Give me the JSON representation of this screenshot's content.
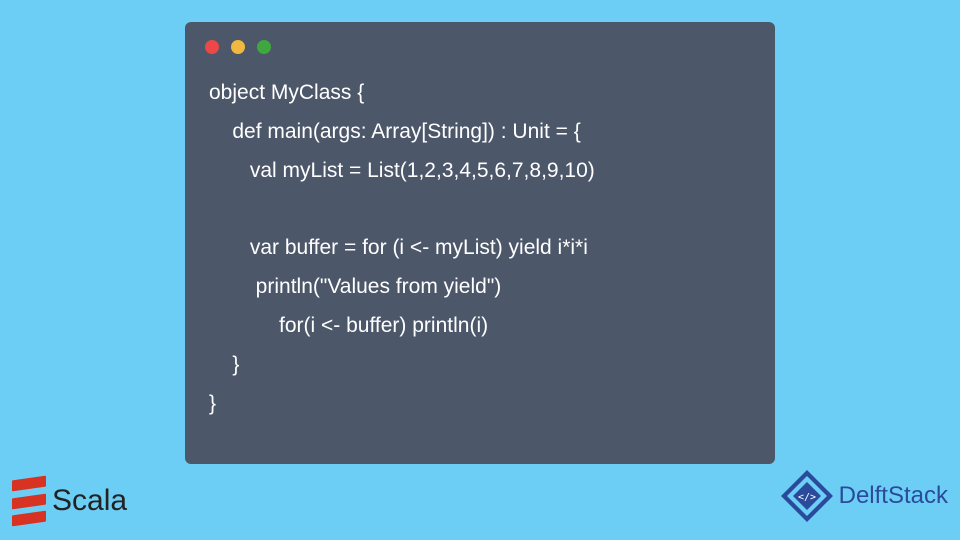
{
  "code": {
    "lines": [
      "object MyClass {",
      "    def main(args: Array[String]) : Unit = {",
      "       val myList = List(1,2,3,4,5,6,7,8,9,10)",
      "",
      "       var buffer = for (i <- myList) yield i*i*i",
      "        println(\"Values from yield\")",
      "            for(i <- buffer) println(i)",
      "    }",
      "}"
    ]
  },
  "logos": {
    "scala_text": "Scala",
    "delft_text": "DelftStack"
  }
}
